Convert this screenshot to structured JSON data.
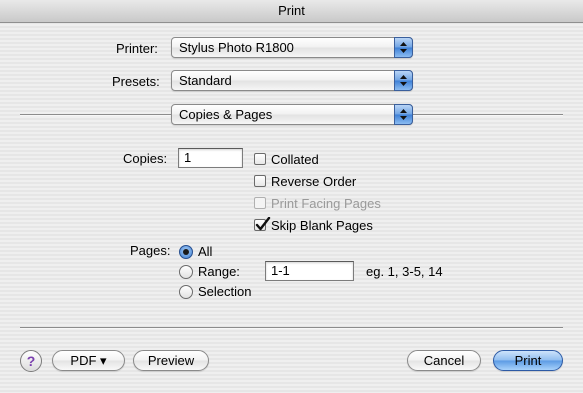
{
  "window": {
    "title": "Print"
  },
  "printer": {
    "label": "Printer:",
    "value": "Stylus Photo R1800"
  },
  "presets": {
    "label": "Presets:",
    "value": "Standard"
  },
  "panel": {
    "value": "Copies & Pages"
  },
  "copies": {
    "label": "Copies:",
    "value": "1",
    "options": [
      {
        "label": "Collated",
        "checked": false,
        "enabled": true
      },
      {
        "label": "Reverse Order",
        "checked": false,
        "enabled": true
      },
      {
        "label": "Print Facing Pages",
        "checked": false,
        "enabled": false
      },
      {
        "label": "Skip Blank Pages",
        "checked": true,
        "enabled": true
      }
    ]
  },
  "pages": {
    "label": "Pages:",
    "options": [
      {
        "label": "All",
        "selected": true
      },
      {
        "label": "Range:",
        "selected": false
      },
      {
        "label": "Selection",
        "selected": false
      }
    ],
    "range_value": "1-1",
    "range_hint": "eg. 1, 3-5, 14"
  },
  "footer": {
    "help_label": "?",
    "pdf_label": "PDF ▾",
    "preview_label": "Preview",
    "cancel_label": "Cancel",
    "print_label": "Print"
  }
}
